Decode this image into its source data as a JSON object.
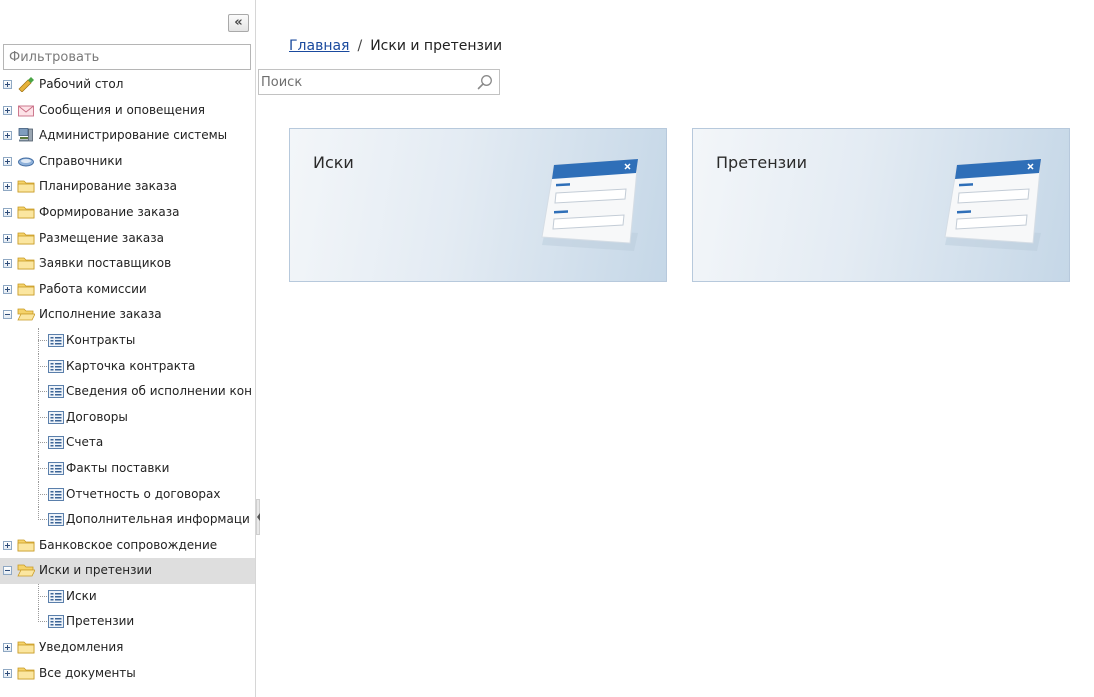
{
  "sidebar": {
    "collapse_label": "«",
    "filter_placeholder": "Фильтровать",
    "items": [
      {
        "label": "Рабочий стол",
        "icon": "desktop-brush-icon",
        "toggle": "plus"
      },
      {
        "label": "Сообщения и оповещения",
        "icon": "envelope-icon",
        "toggle": "plus"
      },
      {
        "label": "Администрирование системы",
        "icon": "computer-icon",
        "toggle": "plus"
      },
      {
        "label": "Справочники",
        "icon": "reference-book-icon",
        "toggle": "plus"
      },
      {
        "label": "Планирование заказа",
        "icon": "folder-icon",
        "toggle": "plus"
      },
      {
        "label": "Формирование заказа",
        "icon": "folder-icon",
        "toggle": "plus"
      },
      {
        "label": "Размещение заказа",
        "icon": "folder-icon",
        "toggle": "plus"
      },
      {
        "label": "Заявки поставщиков",
        "icon": "folder-icon",
        "toggle": "plus"
      },
      {
        "label": "Работа комиссии",
        "icon": "folder-icon",
        "toggle": "plus"
      },
      {
        "label": "Исполнение заказа",
        "icon": "folder-open-icon",
        "toggle": "minus"
      },
      {
        "label": "Контракты",
        "icon": "list-icon",
        "child": true
      },
      {
        "label": "Карточка контракта",
        "icon": "list-icon",
        "child": true
      },
      {
        "label": "Сведения об исполнении кон",
        "icon": "list-icon",
        "child": true
      },
      {
        "label": "Договоры",
        "icon": "list-icon",
        "child": true
      },
      {
        "label": "Счета",
        "icon": "list-icon",
        "child": true
      },
      {
        "label": "Факты поставки",
        "icon": "list-icon",
        "child": true
      },
      {
        "label": "Отчетность о договорах",
        "icon": "list-icon",
        "child": true
      },
      {
        "label": "Дополнительная информаци",
        "icon": "list-icon",
        "child": true
      },
      {
        "label": "Банковское сопровождение",
        "icon": "folder-icon",
        "toggle": "plus"
      },
      {
        "label": "Иски и претензии",
        "icon": "folder-open-icon",
        "toggle": "minus",
        "selected": true
      },
      {
        "label": "Иски",
        "icon": "list-icon",
        "child": true
      },
      {
        "label": "Претензии",
        "icon": "list-icon",
        "child": true
      },
      {
        "label": "Уведомления",
        "icon": "folder-icon",
        "toggle": "plus"
      },
      {
        "label": "Все документы",
        "icon": "folder-icon",
        "toggle": "plus"
      }
    ]
  },
  "breadcrumb": {
    "home": "Главная",
    "separator": "/",
    "current": "Иски и претензии"
  },
  "search": {
    "placeholder": "Поиск",
    "icon": "search-icon"
  },
  "tiles": [
    {
      "title": "Иски",
      "icon": "form-window-icon"
    },
    {
      "title": "Претензии",
      "icon": "form-window-icon"
    }
  ],
  "colors": {
    "link": "#1a4a9e",
    "selected_row": "#dedede",
    "folder": "#f5d36b",
    "tile_accent": "#2f6fb8"
  }
}
